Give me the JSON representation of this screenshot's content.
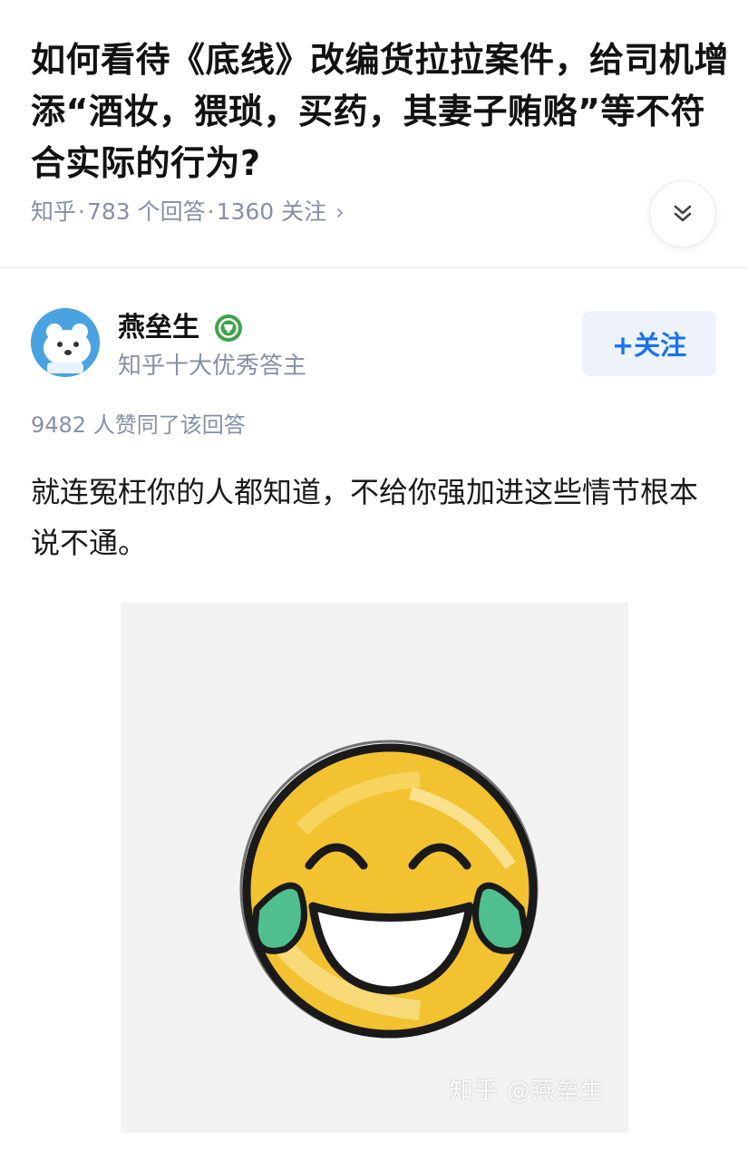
{
  "question": {
    "title": "如何看待《底线》改编货拉拉案件，给司机增添“酒妆，猥琐，买药，其妻子贿赂”等不符合实际的行为?",
    "source": "知乎",
    "answers": "783 个回答",
    "followers": "1360 关注",
    "sep": "·",
    "chevron": "›"
  },
  "author": {
    "name": "燕垒生",
    "headline": "知乎十大优秀答主",
    "follow_label": "+关注",
    "badge_icon": "medal-icon",
    "avatar_icon": "polar-bear-avatar"
  },
  "answer": {
    "votes": "9482 人赞同了该回答",
    "text": "就连冤枉你的人都知道，不给你强加进这些情节根本说不通。",
    "image_watermark": "知乎 @燕垒生",
    "image_icon": "laughing-tears-emoji"
  },
  "colors": {
    "accent": "#1772f6",
    "meta_gray": "#8590a6",
    "emoji_yellow": "#f2c230",
    "tear_green": "#4fbf8f"
  }
}
